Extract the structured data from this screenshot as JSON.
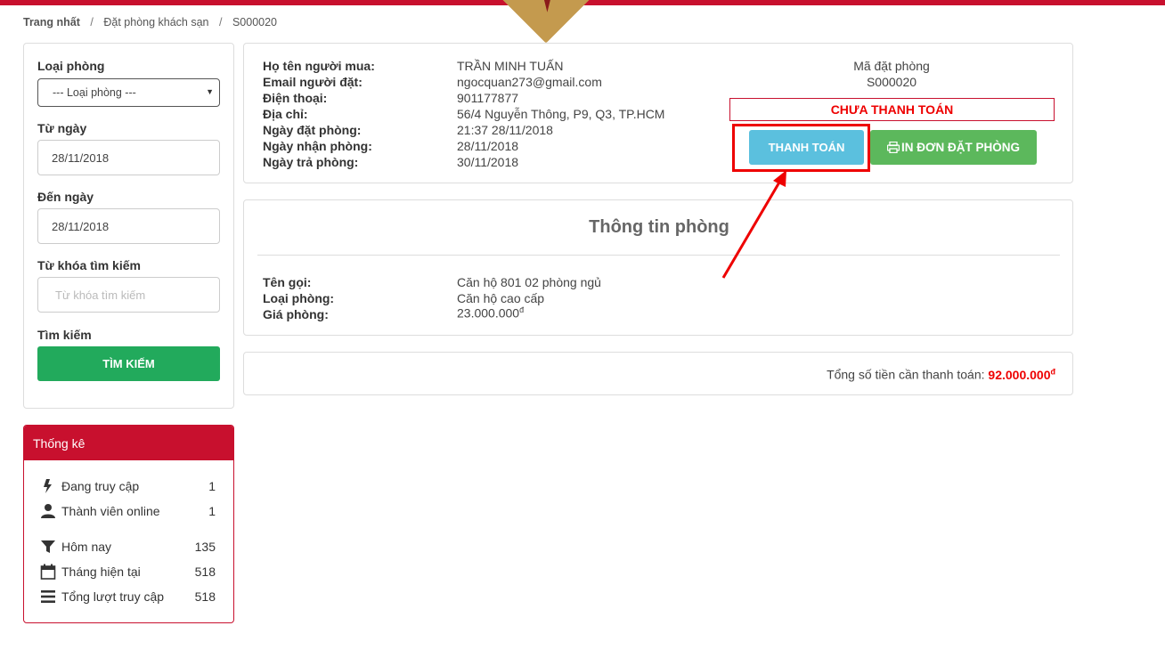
{
  "breadcrumb": {
    "home": "Trang nhất",
    "section": "Đặt phòng khách sạn",
    "current": "S000020"
  },
  "filter": {
    "room_type_label": "Loại phòng",
    "room_type_value": "--- Loại phòng ---",
    "from_label": "Từ ngày",
    "from_value": "28/11/2018",
    "to_label": "Đến ngày",
    "to_value": "28/11/2018",
    "keyword_label": "Từ khóa tìm kiếm",
    "keyword_placeholder": "Từ khóa tìm kiếm",
    "search_label": "Tìm kiếm",
    "search_button": "TÌM KIẾM"
  },
  "stats": {
    "title": "Thống kê",
    "items": [
      {
        "label": "Đang truy cập",
        "value": "1",
        "icon": "bolt-icon"
      },
      {
        "label": "Thành viên online",
        "value": "1",
        "icon": "user-icon"
      },
      {
        "label": "Hôm nay",
        "value": "135",
        "icon": "filter-icon"
      },
      {
        "label": "Tháng hiện tại",
        "value": "518",
        "icon": "calendar-icon"
      },
      {
        "label": "Tổng lượt truy cập",
        "value": "518",
        "icon": "bars-icon"
      }
    ]
  },
  "booking": {
    "buyer_label": "Họ tên người mua:",
    "buyer_value": "TRẦN MINH TUẤN",
    "email_label": "Email người đặt:",
    "email_value": "ngocquan273@gmail.com",
    "phone_label": "Điện thoại:",
    "phone_value": "901177877",
    "address_label": "Địa chỉ:",
    "address_value": "56/4 Nguyễn Thông, P9, Q3, TP.HCM",
    "booked_label": "Ngày đặt phòng:",
    "booked_value": "21:37 28/11/2018",
    "checkin_label": "Ngày nhận phòng:",
    "checkin_value": "28/11/2018",
    "checkout_label": "Ngày trả phòng:",
    "checkout_value": "30/11/2018",
    "code_label": "Mã đặt phòng",
    "code_value": "S000020",
    "status": "CHƯA THANH TOÁN",
    "pay_button": "THANH TOÁN",
    "print_button": "IN ĐƠN ĐẶT PHÒNG"
  },
  "room": {
    "title": "Thông tin phòng",
    "name_label": "Tên gọi:",
    "name_value": "Căn hộ 801 02 phòng ngủ",
    "type_label": "Loại phòng:",
    "type_value": "Căn hộ cao cấp",
    "price_label": "Giá phòng:",
    "price_value": "23.000.000",
    "currency": "đ"
  },
  "total": {
    "label": "Tổng số tiền cần thanh toán:",
    "value": "92.000.000",
    "currency": "đ"
  },
  "colors": {
    "brand_red": "#c8102e",
    "pay_blue": "#5bc0de",
    "print_green": "#5cb85c",
    "search_green": "#22aa5c",
    "annotation_red": "#e00000"
  }
}
